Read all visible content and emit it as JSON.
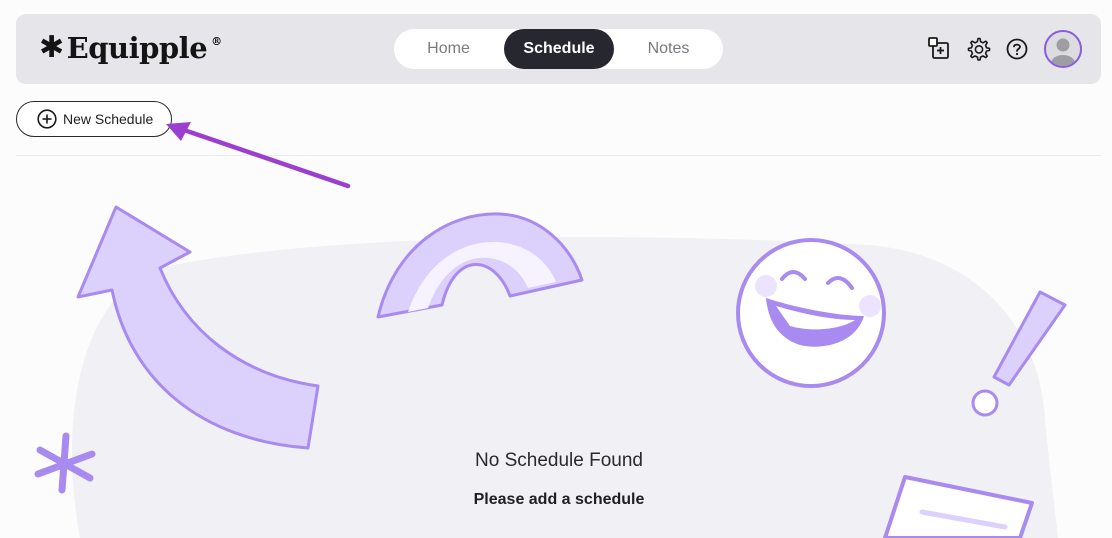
{
  "header": {
    "logo_text": "Equipple",
    "logo_registered": "®",
    "tabs": [
      {
        "label": "Home"
      },
      {
        "label": "Schedule"
      },
      {
        "label": "Notes"
      }
    ],
    "active_tab": "Schedule",
    "icons": [
      "add-note-icon",
      "settings-icon",
      "help-icon",
      "avatar"
    ]
  },
  "toolbar": {
    "new_schedule_label": "New Schedule"
  },
  "empty_state": {
    "title": "No Schedule Found",
    "subtitle": "Please add a schedule"
  },
  "colors": {
    "accent_purple": "#9b6ee8",
    "illustration_fill": "#dcd0fc",
    "illustration_stroke": "#a98af0",
    "active_tab": "#27272f",
    "header_bg": "#e6e5ea",
    "annotation_arrow": "#9b3fd0"
  }
}
